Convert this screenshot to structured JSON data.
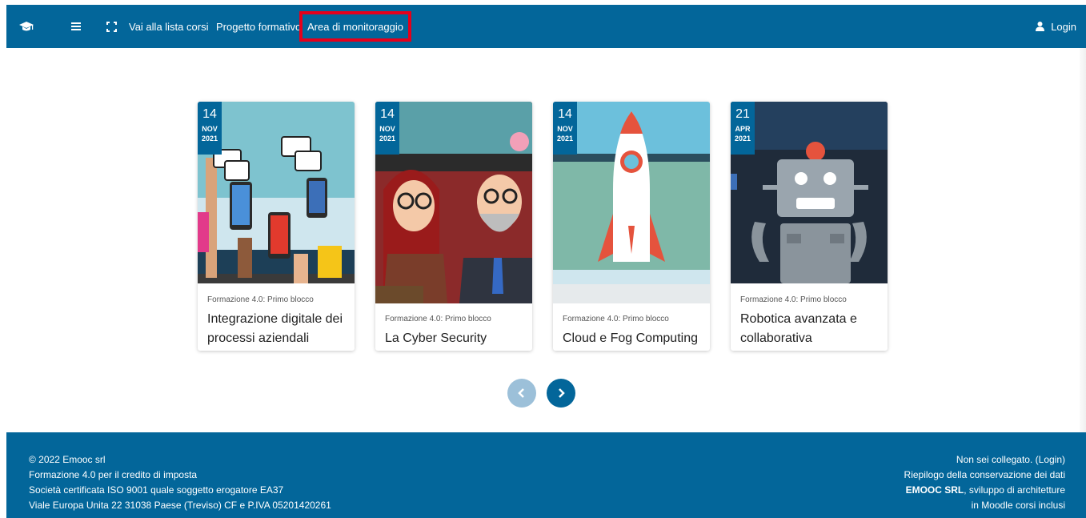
{
  "nav": {
    "links": [
      "Vai alla lista corsi",
      "Progetto formativo",
      "Area di monitoraggio"
    ],
    "login": "Login"
  },
  "cards": [
    {
      "day": "14",
      "month": "NOV",
      "year": "2021",
      "category": "Formazione 4.0: Primo blocco",
      "title": "Integrazione digitale dei processi aziendali"
    },
    {
      "day": "14",
      "month": "NOV",
      "year": "2021",
      "category": "Formazione 4.0: Primo blocco",
      "title": "La Cyber Security"
    },
    {
      "day": "14",
      "month": "NOV",
      "year": "2021",
      "category": "Formazione 4.0: Primo blocco",
      "title": "Cloud e Fog Computing"
    },
    {
      "day": "21",
      "month": "APR",
      "year": "2021",
      "category": "Formazione 4.0: Primo blocco",
      "title": "Robotica avanzata e collaborativa"
    }
  ],
  "footer": {
    "left": [
      "© 2022 Emooc srl",
      "Formazione 4.0 per il credito di imposta",
      "Società certificata ISO 9001 quale soggetto erogatore EA37",
      "Viale Europa Unita 22 31038 Paese (Treviso) CF e P.IVA 05201420261"
    ],
    "right": {
      "not_logged": "Non sei collegato. (Login)",
      "retention": "Riepilogo della conservazione dei dati",
      "brand": "EMOOC SRL",
      "brand_rest": ", sviluppo di architetture",
      "last": "in Moodle corsi inclusi"
    }
  },
  "colors": {
    "primary": "#03669a",
    "highlight": "#e4001b"
  }
}
